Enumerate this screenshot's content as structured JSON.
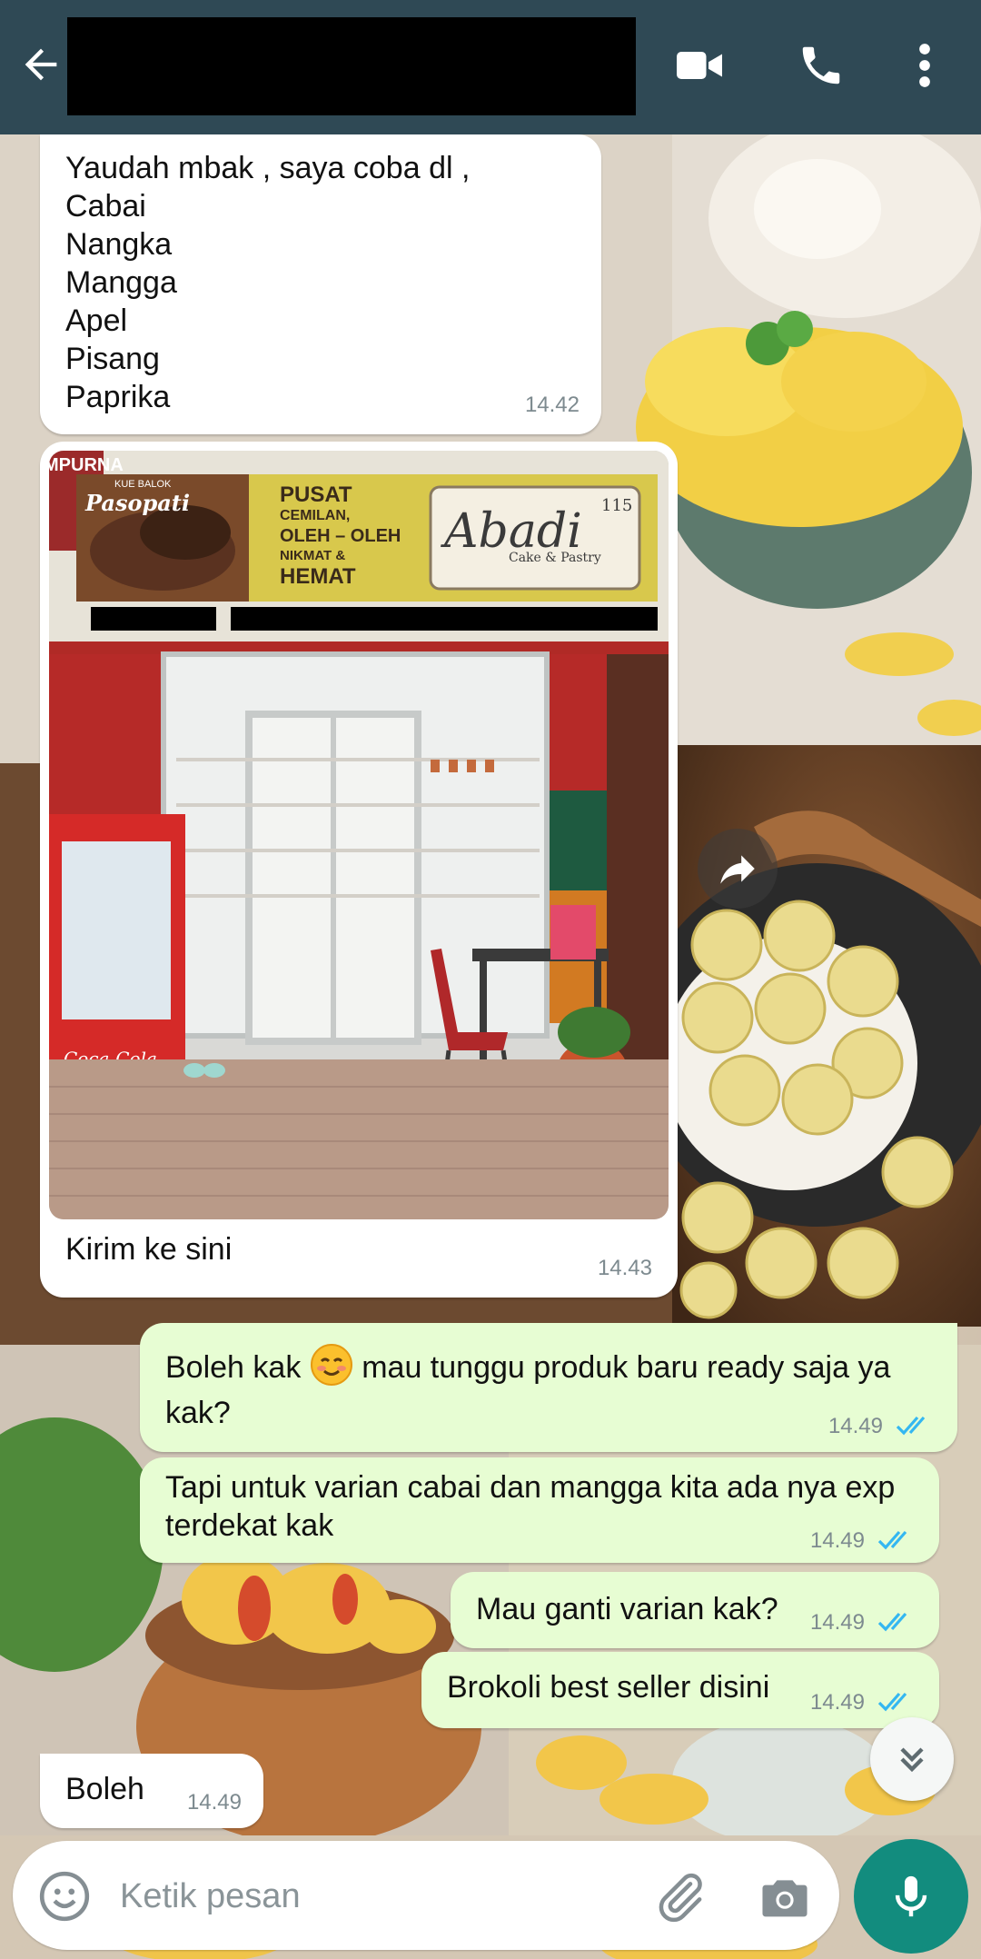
{
  "header": {
    "contact_name": "",
    "back_icon": "arrow-left-icon",
    "video_icon": "video-camera-icon",
    "call_icon": "phone-icon",
    "menu_icon": "more-vertical-icon"
  },
  "messages": [
    {
      "direction": "incoming",
      "text": "Yaudah mbak , saya coba dl ,\nCabai\nNangka\nMangga\nApel\nPisang\nPaprika",
      "time": "14.42"
    },
    {
      "direction": "incoming",
      "type": "image",
      "caption": "Kirim ke sini",
      "time": "14.43",
      "image": {
        "sign_small": "KUE BALOK",
        "sign_brand_left": "Pasopati",
        "sign_lines": [
          "PUSAT",
          "CEMILAN,",
          "OLEH – OLEH",
          "NIKMAT &",
          "HEMAT"
        ],
        "sign_logo": "Abadi",
        "sign_logo_number": "115",
        "sign_logo_sub": "Cake & Pastry",
        "corner_text": "MPURNA",
        "fridge_brand": "Coca-Cola"
      }
    },
    {
      "direction": "outgoing",
      "text_before": "Boleh kak ",
      "emoji": "smiling-face-emoji",
      "text_after": " mau tunggu produk baru ready saja ya kak?",
      "time": "14.49",
      "status": "read"
    },
    {
      "direction": "outgoing",
      "text": "Tapi untuk varian cabai dan mangga kita ada nya exp terdekat kak",
      "time": "14.49",
      "status": "read"
    },
    {
      "direction": "outgoing",
      "text": "Mau ganti varian kak?",
      "time": "14.49",
      "status": "read"
    },
    {
      "direction": "outgoing",
      "text": "Brokoli best seller disini",
      "time": "14.49",
      "status": "read"
    },
    {
      "direction": "incoming",
      "text": "Boleh",
      "time": "14.49"
    }
  ],
  "composer": {
    "placeholder": "Ketik pesan",
    "value": "",
    "emoji_icon": "emoji-icon",
    "attach_icon": "paperclip-icon",
    "camera_icon": "camera-icon",
    "mic_icon": "microphone-icon"
  },
  "colors": {
    "header": "#2f4955",
    "outgoing_bubble": "#e7fdd3",
    "incoming_bubble": "#ffffff",
    "accent": "#128c7e",
    "read_ticks": "#34b7f1"
  }
}
